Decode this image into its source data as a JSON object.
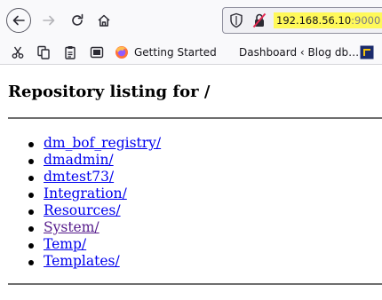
{
  "browser": {
    "url_host": "192.168.56.10",
    "url_port": ":9000",
    "url_highlight_color": "#fff95a"
  },
  "bookmarks": [
    {
      "label": "",
      "icon": "cut-icon"
    },
    {
      "label": "",
      "icon": "copy-icon"
    },
    {
      "label": "",
      "icon": "paste-icon"
    },
    {
      "label": "",
      "icon": "screenshot-icon"
    },
    {
      "label": "Getting Started",
      "icon": "firefox-icon"
    },
    {
      "label": "Dashboard ‹ Blog db…",
      "icon": ""
    },
    {
      "label": "",
      "icon": "dvwa-icon"
    }
  ],
  "page": {
    "title": "Repository listing for /",
    "items": [
      {
        "label": "dm_bof_registry/",
        "visited": false
      },
      {
        "label": "dmadmin/",
        "visited": false
      },
      {
        "label": "dmtest73/",
        "visited": false
      },
      {
        "label": "Integration/",
        "visited": false
      },
      {
        "label": "Resources/",
        "visited": false
      },
      {
        "label": "System/",
        "visited": true
      },
      {
        "label": "Temp/",
        "visited": false
      },
      {
        "label": "Templates/",
        "visited": false
      }
    ]
  },
  "colors": {
    "link": "#0000ee",
    "visited_link": "#551a8b"
  }
}
